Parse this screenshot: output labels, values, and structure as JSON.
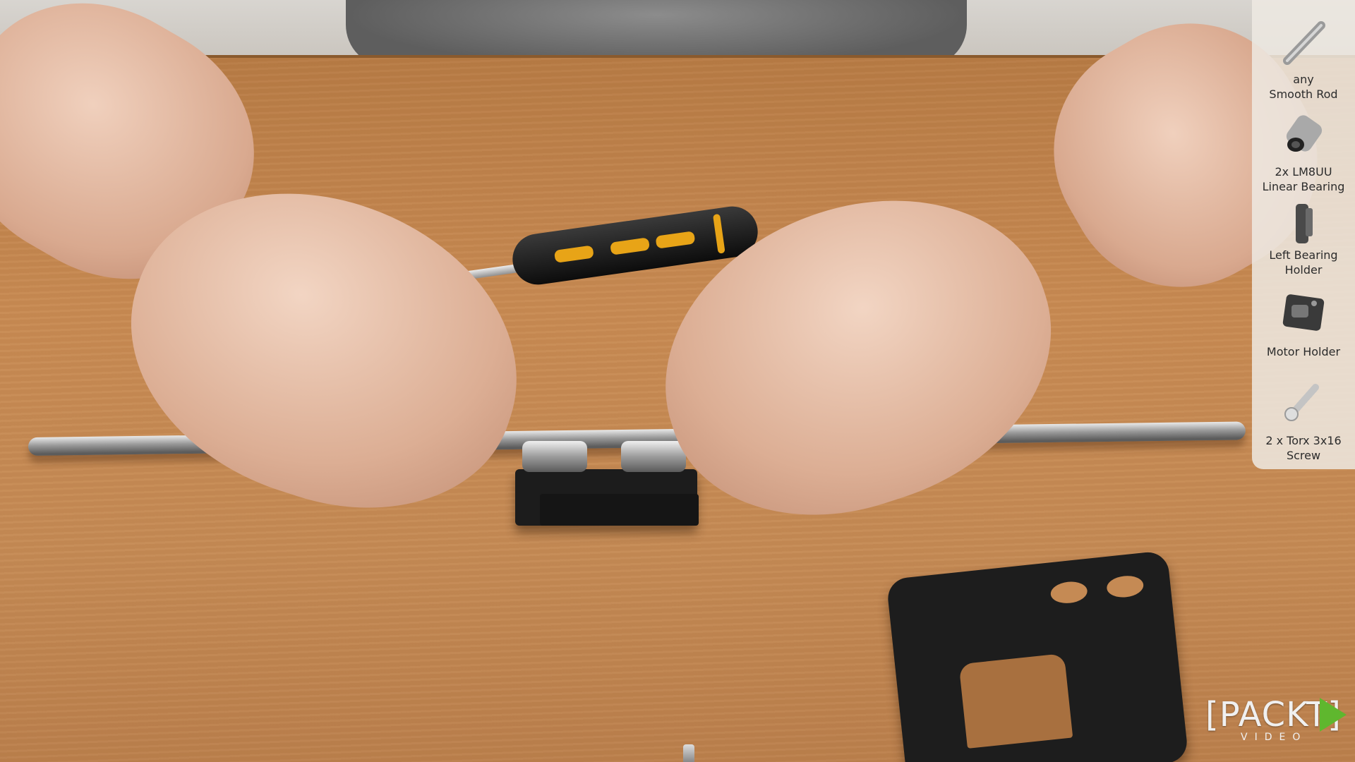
{
  "parts_panel": {
    "items": [
      {
        "icon": "smooth-rod-icon",
        "line1": "any",
        "line2": "Smooth Rod"
      },
      {
        "icon": "linear-bearing-icon",
        "line1": "2x LM8UU",
        "line2": "Linear Bearing"
      },
      {
        "icon": "bearing-holder-icon",
        "line1": "Left Bearing",
        "line2": "Holder"
      },
      {
        "icon": "motor-holder-icon",
        "line1": "Motor Holder",
        "line2": ""
      },
      {
        "icon": "torx-screw-icon",
        "line1": "2 x Torx 3x16",
        "line2": "Screw"
      }
    ]
  },
  "logo": {
    "word": "[PACKT]",
    "sub": "VIDEO",
    "accent_color": "#5fb72e"
  }
}
